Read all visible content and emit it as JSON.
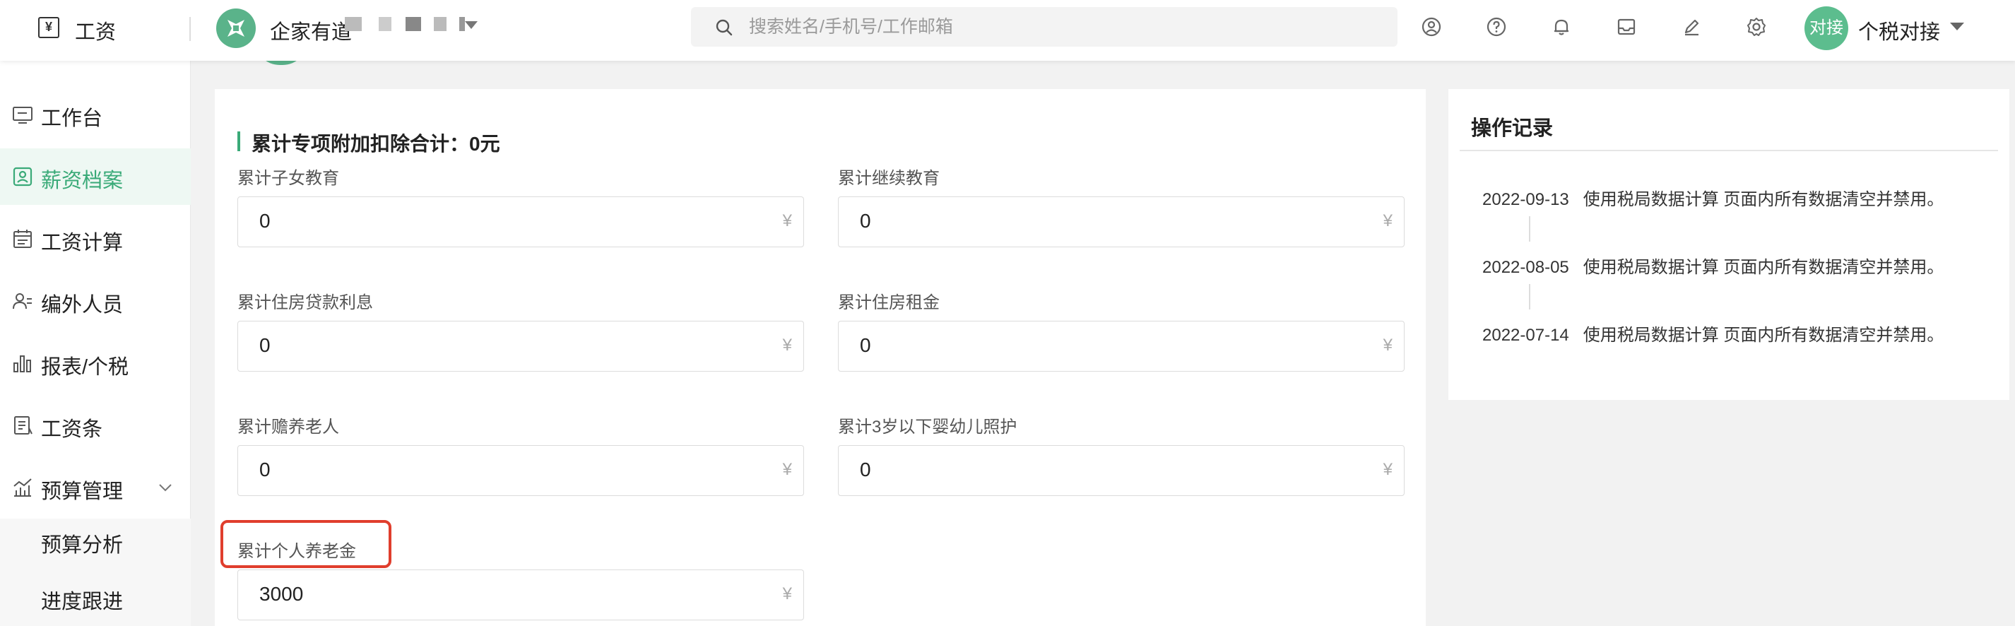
{
  "header": {
    "app_title": "工资",
    "company_name": "企家有道",
    "search_placeholder": "搜索姓名/手机号/工作邮箱",
    "avatar_text": "对接",
    "user_name": "个税对接",
    "icons": [
      "user-circle-icon",
      "help-icon",
      "bell-icon",
      "inbox-icon",
      "edit-icon",
      "gear-icon"
    ]
  },
  "sidebar": {
    "items": [
      {
        "label": "工作台",
        "icon": "monitor-icon"
      },
      {
        "label": "薪资档案",
        "icon": "profile-icon",
        "active": true
      },
      {
        "label": "工资计算",
        "icon": "calendar-icon"
      },
      {
        "label": "编外人员",
        "icon": "people-icon"
      },
      {
        "label": "报表/个税",
        "icon": "bar-chart-icon"
      },
      {
        "label": "工资条",
        "icon": "document-icon"
      },
      {
        "label": "预算管理",
        "icon": "trend-chart-icon",
        "expanded": true
      }
    ],
    "sub_items": [
      {
        "label": "预算分析"
      },
      {
        "label": "进度跟进"
      }
    ]
  },
  "form": {
    "section_title": "累计专项附加扣除合计：0元",
    "currency_unit": "¥",
    "fields": [
      {
        "label": "累计子女教育",
        "value": "0"
      },
      {
        "label": "累计继续教育",
        "value": "0"
      },
      {
        "label": "累计住房贷款利息",
        "value": "0"
      },
      {
        "label": "累计住房租金",
        "value": "0"
      },
      {
        "label": "累计赡养老人",
        "value": "0"
      },
      {
        "label": "累计3岁以下婴幼儿照护",
        "value": "0"
      },
      {
        "label": "累计个人养老金",
        "value": "3000"
      }
    ]
  },
  "log": {
    "title": "操作记录",
    "entries": [
      {
        "date": "2022-09-13",
        "text": "使用税局数据计算 页面内所有数据清空并禁用。"
      },
      {
        "date": "2022-08-05",
        "text": "使用税局数据计算 页面内所有数据清空并禁用。"
      },
      {
        "date": "2022-07-14",
        "text": "使用税局数据计算 页面内所有数据清空并禁用。"
      }
    ]
  },
  "colors": {
    "accent": "#3aaa78",
    "active_bg": "#eef8f3",
    "highlight_border": "#e03e2d"
  }
}
